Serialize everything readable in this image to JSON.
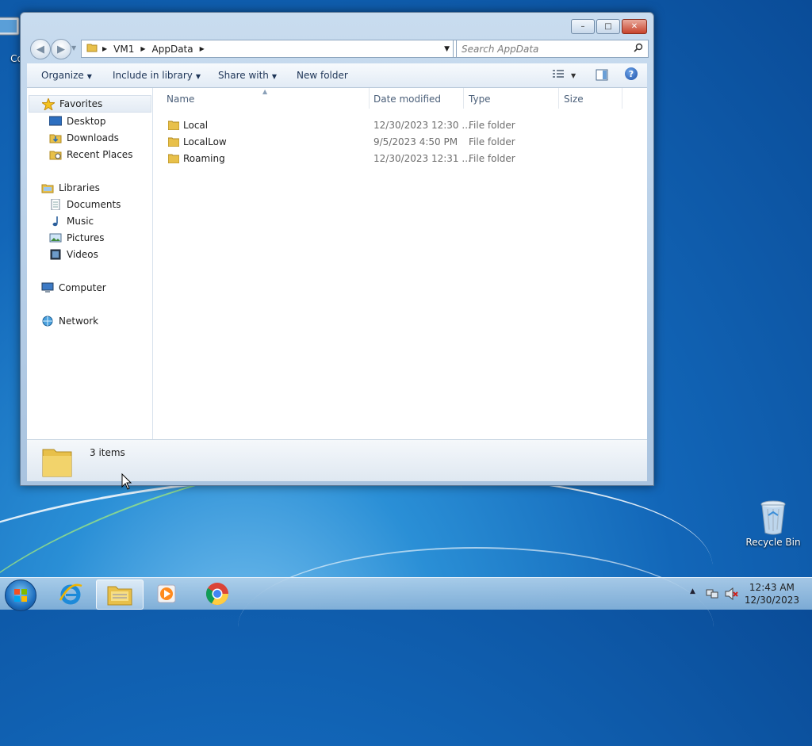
{
  "desktop": {
    "left_icon_label": "Co",
    "recycle_bin_label": "Recycle Bin"
  },
  "window": {
    "caption": {
      "minimize": "–",
      "maximize": "□",
      "close": "✕"
    },
    "address": {
      "segments": [
        "VM1",
        "AppData"
      ]
    },
    "search": {
      "placeholder": "Search AppData"
    },
    "toolbar": {
      "organize": "Organize",
      "include_in_library": "Include in library",
      "share_with": "Share with",
      "new_folder": "New folder"
    },
    "nav": {
      "favorites": "Favorites",
      "desktop": "Desktop",
      "downloads": "Downloads",
      "recent_places": "Recent Places",
      "libraries": "Libraries",
      "documents": "Documents",
      "music": "Music",
      "pictures": "Pictures",
      "videos": "Videos",
      "computer": "Computer",
      "network": "Network"
    },
    "columns": {
      "name": "Name",
      "date_modified": "Date modified",
      "type": "Type",
      "size": "Size"
    },
    "files": [
      {
        "name": "Local",
        "date": "12/30/2023 12:30 ...",
        "type": "File folder"
      },
      {
        "name": "LocalLow",
        "date": "9/5/2023 4:50 PM",
        "type": "File folder"
      },
      {
        "name": "Roaming",
        "date": "12/30/2023 12:31 ...",
        "type": "File folder"
      }
    ],
    "details": {
      "item_count": "3 items"
    }
  },
  "taskbar": {
    "clock_time": "12:43 AM",
    "clock_date": "12/30/2023"
  },
  "colors": {
    "desktop_blue": "#1266b8",
    "window_frame": "#b5cde6",
    "folder_yellow": "#e8c04a"
  }
}
